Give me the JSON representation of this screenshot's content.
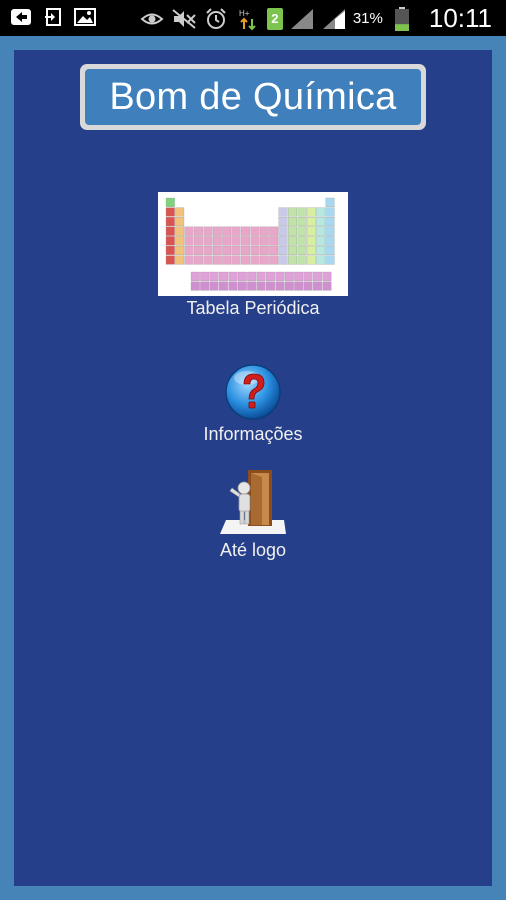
{
  "status_bar": {
    "battery_percent": "31%",
    "battery_level": 0.31,
    "sim_badge": "2",
    "time": "10:11",
    "icons_left": [
      "usb-icon",
      "sync-icon",
      "image-icon"
    ],
    "icons_right": [
      "eye-icon",
      "mute-icon",
      "alarm-icon",
      "data-transfer-icon",
      "sim-icon",
      "signal-icon",
      "signal-icon",
      "battery-icon"
    ]
  },
  "app": {
    "title": "Bom de Química",
    "menu": [
      {
        "label": "Tabela Periódica",
        "icon": "periodic-table-icon"
      },
      {
        "label": "Informações",
        "icon": "question-icon"
      },
      {
        "label": "Até logo",
        "icon": "exit-door-icon"
      }
    ]
  },
  "colors": {
    "frame": "#4684b8",
    "panel": "#263f8a",
    "title_button": "#3f7fbc",
    "title_border": "#d9d9d9"
  }
}
